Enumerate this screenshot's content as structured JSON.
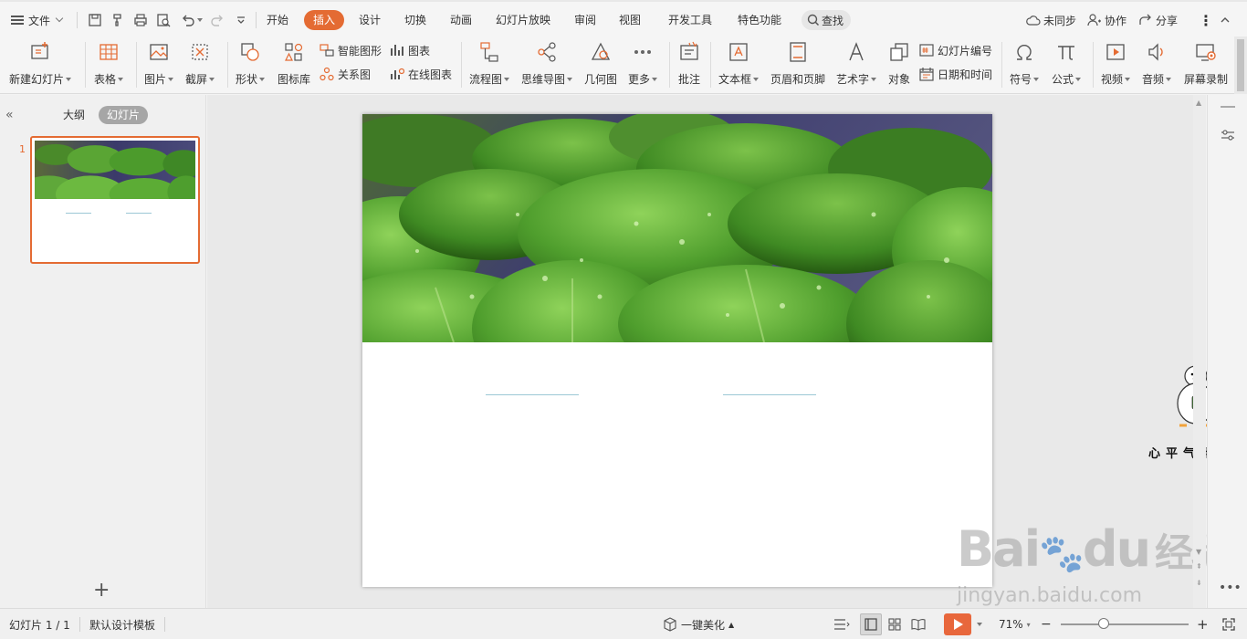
{
  "topbar": {
    "file_label": "文件",
    "tabs": [
      "开始",
      "插入",
      "设计",
      "切换",
      "动画",
      "幻灯片放映",
      "审阅",
      "视图",
      "开发工具",
      "特色功能"
    ],
    "active_tab": "插入",
    "search_label": "查找",
    "sync_label": "未同步",
    "collab_label": "协作",
    "share_label": "分享"
  },
  "ribbon": {
    "new_slide": "新建幻灯片",
    "table": "表格",
    "picture": "图片",
    "screenshot": "截屏",
    "shape": "形状",
    "icon_lib": "图标库",
    "smart_art": "智能图形",
    "chart": "图表",
    "relation": "关系图",
    "online_chart": "在线图表",
    "flowchart": "流程图",
    "mindmap": "思维导图",
    "geometry": "几何图",
    "more": "更多",
    "comment": "批注",
    "textbox": "文本框",
    "header_footer": "页眉和页脚",
    "wordart": "艺术字",
    "object": "对象",
    "slide_number": "幻灯片编号",
    "datetime": "日期和时间",
    "symbol": "符号",
    "formula": "公式",
    "video": "视频",
    "audio": "音频",
    "screen_record": "屏幕录制"
  },
  "leftpanel": {
    "outline_tab": "大纲",
    "slides_tab": "幻灯片",
    "slide_number": "1"
  },
  "sidebar_widget": {
    "caption": "心平气和鸭"
  },
  "watermark": {
    "brand_a": "Bai",
    "brand_b": "du",
    "brand_c": "经验",
    "url": "jingyan.baidu.com"
  },
  "statusbar": {
    "slide_info": "幻灯片 1 / 1",
    "template": "默认设计模板",
    "beautify": "一键美化",
    "zoom": "71%"
  },
  "colors": {
    "accent": "#e46b33",
    "thumb_border": "#e46b33",
    "placeholder_line": "#9cc8d6"
  }
}
